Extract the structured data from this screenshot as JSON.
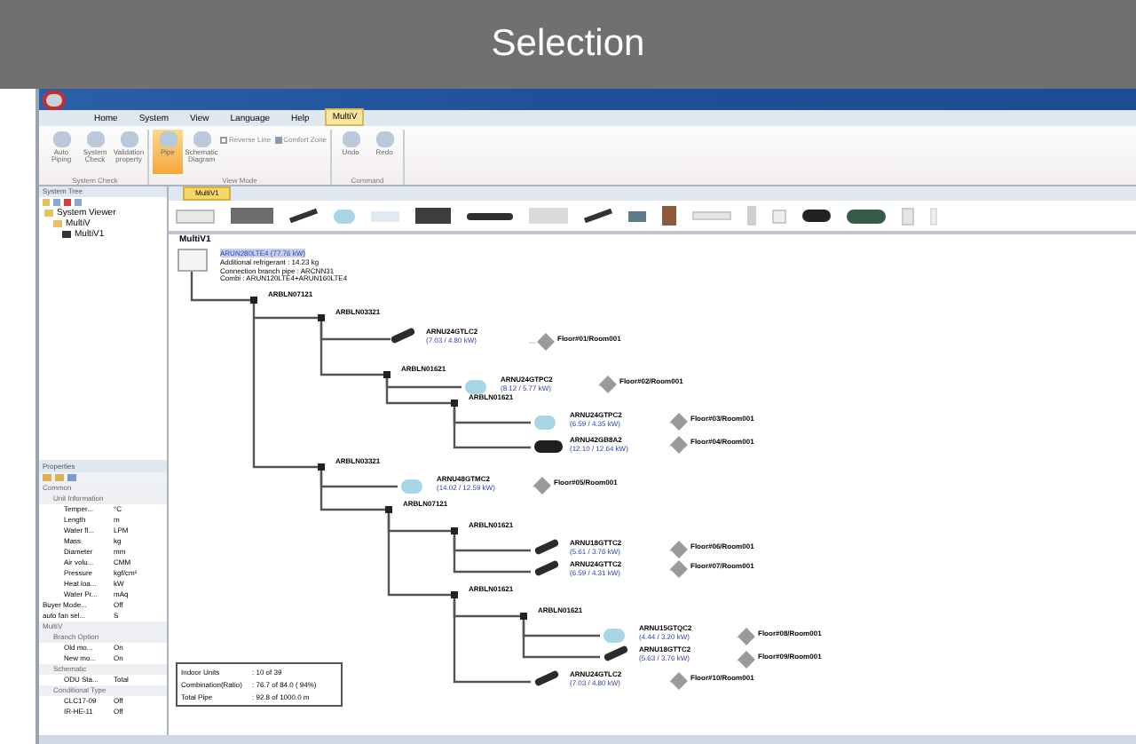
{
  "banner": {
    "title": "Selection"
  },
  "ribbon": {
    "tabs": [
      {
        "label": "Home",
        "selected": false
      },
      {
        "label": "System",
        "selected": false
      },
      {
        "label": "View",
        "selected": false
      },
      {
        "label": "Language",
        "selected": false
      },
      {
        "label": "Help",
        "selected": false
      },
      {
        "label": "MultiV",
        "selected": true
      }
    ],
    "groups": [
      {
        "label": "System Check",
        "buttons": [
          {
            "label": "Auto Piping",
            "selected": false
          },
          {
            "label": "System Check",
            "selected": false
          },
          {
            "label": "Validation property",
            "selected": false
          }
        ]
      },
      {
        "label": "View Mode",
        "buttons": [
          {
            "label": "Pipe",
            "selected": true
          },
          {
            "label": "Schematic Diagram",
            "selected": false
          }
        ],
        "checks": [
          {
            "label": "Reverse Line",
            "checked": false
          },
          {
            "label": "Comfort Zone",
            "checked": true
          }
        ]
      },
      {
        "label": "Command",
        "buttons": [
          {
            "label": "Undo",
            "selected": false
          },
          {
            "label": "Redo",
            "selected": false
          }
        ]
      }
    ]
  },
  "system_tree": {
    "title": "System Tree",
    "items": [
      {
        "label": "System Viewer",
        "children": [
          {
            "label": "MultiV",
            "children": [
              {
                "label": "MultiV1"
              }
            ]
          }
        ]
      }
    ]
  },
  "properties": {
    "title": "Properties",
    "rows": [
      {
        "kind": "category",
        "name": "Common"
      },
      {
        "kind": "group",
        "name": "Unit Information"
      },
      {
        "kind": "row",
        "name": "Temper...",
        "value": "°C"
      },
      {
        "kind": "row",
        "name": "Length",
        "value": "m"
      },
      {
        "kind": "row",
        "name": "Water fl...",
        "value": "LPM"
      },
      {
        "kind": "row",
        "name": "Mass",
        "value": "kg"
      },
      {
        "kind": "row",
        "name": "Diameter",
        "value": "mm"
      },
      {
        "kind": "row",
        "name": "Air volu...",
        "value": "CMM"
      },
      {
        "kind": "row",
        "name": "Pressure",
        "value": "kgf/cm²"
      },
      {
        "kind": "row",
        "name": "Heat loa...",
        "value": "kW"
      },
      {
        "kind": "row",
        "name": "Water Pr...",
        "value": "mAq"
      },
      {
        "kind": "toprow",
        "name": "Buyer Mode...",
        "value": "Off"
      },
      {
        "kind": "toprow",
        "name": "auto fan sel...",
        "value": "S"
      },
      {
        "kind": "category",
        "name": "MultiV"
      },
      {
        "kind": "group",
        "name": "Branch Option"
      },
      {
        "kind": "row",
        "name": "Old mo...",
        "value": "On"
      },
      {
        "kind": "row",
        "name": "New mo...",
        "value": "On"
      },
      {
        "kind": "group",
        "name": "Schematic"
      },
      {
        "kind": "row",
        "name": "ODU Sta...",
        "value": "Total"
      },
      {
        "kind": "group",
        "name": "Conditional Type"
      },
      {
        "kind": "row",
        "name": "CLC17-09",
        "value": "Off"
      },
      {
        "kind": "row",
        "name": "IR-HE-11",
        "value": "Off"
      }
    ]
  },
  "document": {
    "tab": "MultiV1",
    "title": "MultiV1",
    "outdoor": {
      "model": "ARUN280LTE4 (77.76 kW)",
      "lines": [
        "Additional refrigerant : 14.23 kg",
        "Connection branch pipe : ARCNN31",
        "Combi : ARUN120LTE4+ARUN160LTE4"
      ]
    },
    "branches": [
      "ARBLN07121",
      "ARBLN03321",
      "ARBLN01621",
      "ARBLN01621",
      "ARBLN03321",
      "ARBLN07121",
      "ARBLN01621",
      "ARBLN01621",
      "ARBLN01621"
    ],
    "indoor_units": [
      {
        "kind": "cassette",
        "model": "ARNU24GTLC2",
        "capacity": "(7.03 / 4.80 kW)",
        "room": "Floor#01/Room001"
      },
      {
        "kind": "round",
        "model": "ARNU24GTPC2",
        "capacity": "(8.12 / 5.77 kW)",
        "room": "Floor#02/Room001"
      },
      {
        "kind": "round",
        "model": "ARNU24GTPC2",
        "capacity": "(6.59 / 4.35 kW)",
        "room": "Floor#03/Room001"
      },
      {
        "kind": "duct",
        "model": "ARNU42GB8A2",
        "capacity": "(12.10 / 12.64 kW)",
        "room": "Floor#04/Room001"
      },
      {
        "kind": "round",
        "model": "ARNU48GTMC2",
        "capacity": "(14.02 / 12.59 kW)",
        "room": "Floor#05/Room001"
      },
      {
        "kind": "cassette",
        "model": "ARNU18GTTC2",
        "capacity": "(5.61 / 3.76 kW)",
        "room": "Floor#06/Room001"
      },
      {
        "kind": "cassette",
        "model": "ARNU24GTTC2",
        "capacity": "(6.59 / 4.31 kW)",
        "room": "Floor#07/Room001"
      },
      {
        "kind": "round",
        "model": "ARNU15GTQC2",
        "capacity": "(4.44 / 3.20 kW)",
        "room": "Floor#08/Room001"
      },
      {
        "kind": "cassette",
        "model": "ARNU18GTTC2",
        "capacity": "(5.63 / 3.76 kW)",
        "room": "Floor#09/Room001"
      },
      {
        "kind": "cassette",
        "model": "ARNU24GTLC2",
        "capacity": "(7.03 / 4.80 kW)",
        "room": "Floor#10/Room001"
      }
    ],
    "summary": [
      {
        "label": "Indoor Units",
        "value": ": 10 of 39"
      },
      {
        "label": "Combination(Ratio)",
        "value": ": 76.7 of 84.0 ( 94%)"
      },
      {
        "label": "Total Pipe",
        "value": ": 92.8 of 1000.0 m"
      }
    ]
  }
}
